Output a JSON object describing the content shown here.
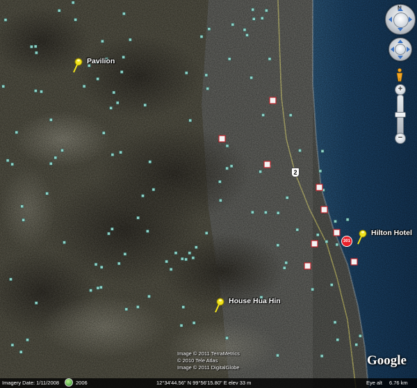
{
  "placemarks": [
    {
      "name": "Pavilion",
      "icon": "yellow-pushpin-icon"
    },
    {
      "name": "Hilton Hotel",
      "icon": "yellow-pushpin-icon"
    },
    {
      "name": "House Hua Hin",
      "icon": "yellow-pushpin-icon"
    }
  ],
  "road": {
    "shield": "2"
  },
  "hotel_badge": {
    "label": "301",
    "color": "#e8202a"
  },
  "navigation": {
    "north_label": "N",
    "zoom_in": "+",
    "zoom_out": "−",
    "zoom_level": 0.5
  },
  "credits": {
    "line1": "Image © 2011 TerraMetrics",
    "line2": "© 2010 Tele Atlas",
    "line3": "Image © 2011 DigitalGlobe"
  },
  "logo": "Google",
  "status_bar": {
    "imagery_date_label": "Imagery Date: 1/11/2008",
    "imagery_year": "2006",
    "coordinates": "12°34'44.56\" N  99°56'15.80\" E  elev  33 m",
    "eye_alt_label": "Eye alt",
    "eye_alt_value": "6.76 km"
  },
  "colors": {
    "sea": "#1a3a5e",
    "land": "#4a4838",
    "pin": "#f2e41c",
    "poi": "#8fd3c8"
  }
}
